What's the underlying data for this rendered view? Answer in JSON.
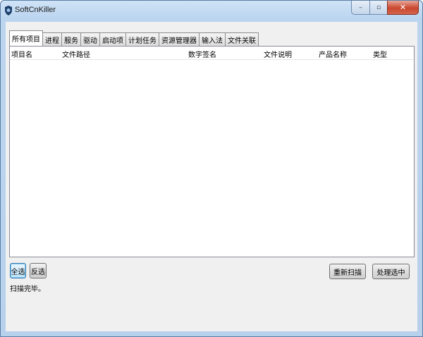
{
  "window": {
    "title": "SoftCnKiller"
  },
  "caption": {
    "minimize": "–",
    "maximize": "▫",
    "close": "✕"
  },
  "tabs": [
    {
      "label": "所有项目",
      "active": true
    },
    {
      "label": "进程"
    },
    {
      "label": "服务"
    },
    {
      "label": "驱动"
    },
    {
      "label": "启动项"
    },
    {
      "label": "计划任务"
    },
    {
      "label": "资源管理器"
    },
    {
      "label": "输入法"
    },
    {
      "label": "文件关联"
    }
  ],
  "table": {
    "columns": [
      "项目名",
      "文件路径",
      "数字签名",
      "文件说明",
      "产品名称",
      "类型"
    ],
    "rows": []
  },
  "buttons": {
    "select_all": "全选",
    "invert": "反选",
    "rescan": "重新扫描",
    "process_selected": "处理选中"
  },
  "status": {
    "text": "扫描完毕。"
  }
}
